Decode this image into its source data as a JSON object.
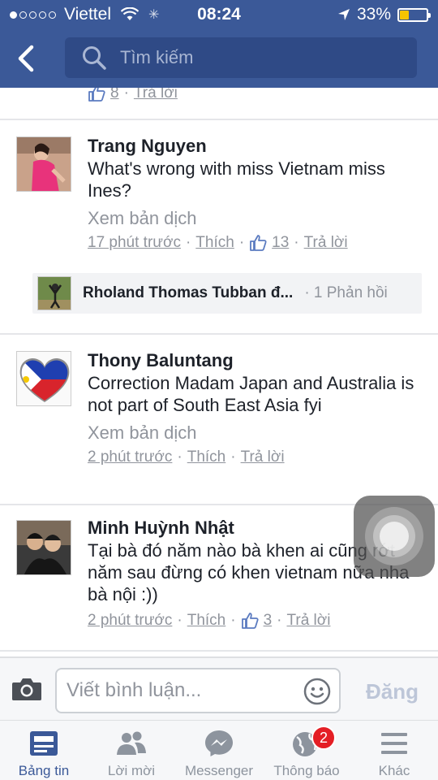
{
  "status_bar": {
    "carrier": "Viettel",
    "time": "08:24",
    "battery_percent_label": "33%",
    "battery_level": 0.33
  },
  "header": {
    "search_placeholder": "Tìm kiếm"
  },
  "top_partial": {
    "likes": "8",
    "reply": "Trả lời"
  },
  "comments": [
    {
      "author": "Trang Nguyen",
      "text": "What's wrong with miss Vietnam miss Ines?",
      "translate": "Xem bản dịch",
      "time": "17 phút trước",
      "like": "Thích",
      "likes": "13",
      "reply": "Trả lời",
      "reply_preview": {
        "name": "Rholand Thomas Tubban đ...",
        "count": "· 1 Phản hồi"
      }
    },
    {
      "author": "Thony Baluntang",
      "text": "Correction Madam Japan and Australia is not part of South East Asia fyi",
      "translate": "Xem bản dịch",
      "time": "2 phút trước",
      "like": "Thích",
      "reply": "Trả lời"
    },
    {
      "author": "Minh Huỳnh Nhật",
      "text": "Tại bà đó năm nào bà khen ai cũng rớt năm sau đừng có khen vietnam nữa nha bà nội :))",
      "time": "2 phút trước",
      "like": "Thích",
      "likes": "3",
      "reply": "Trả lời"
    }
  ],
  "composer": {
    "placeholder": "Viết bình luận...",
    "post_label": "Đăng"
  },
  "tabs": [
    {
      "label": "Bảng tin",
      "icon": "news-feed-icon",
      "active": true
    },
    {
      "label": "Lời mời",
      "icon": "friend-requests-icon"
    },
    {
      "label": "Messenger",
      "icon": "messenger-icon"
    },
    {
      "label": "Thông báo",
      "icon": "globe-icon",
      "badge": "2"
    },
    {
      "label": "Khác",
      "icon": "menu-icon"
    }
  ],
  "colors": {
    "brand": "#3b5998",
    "meta_text": "#90949c",
    "badge": "#e41e25",
    "battery": "#f5c400"
  }
}
